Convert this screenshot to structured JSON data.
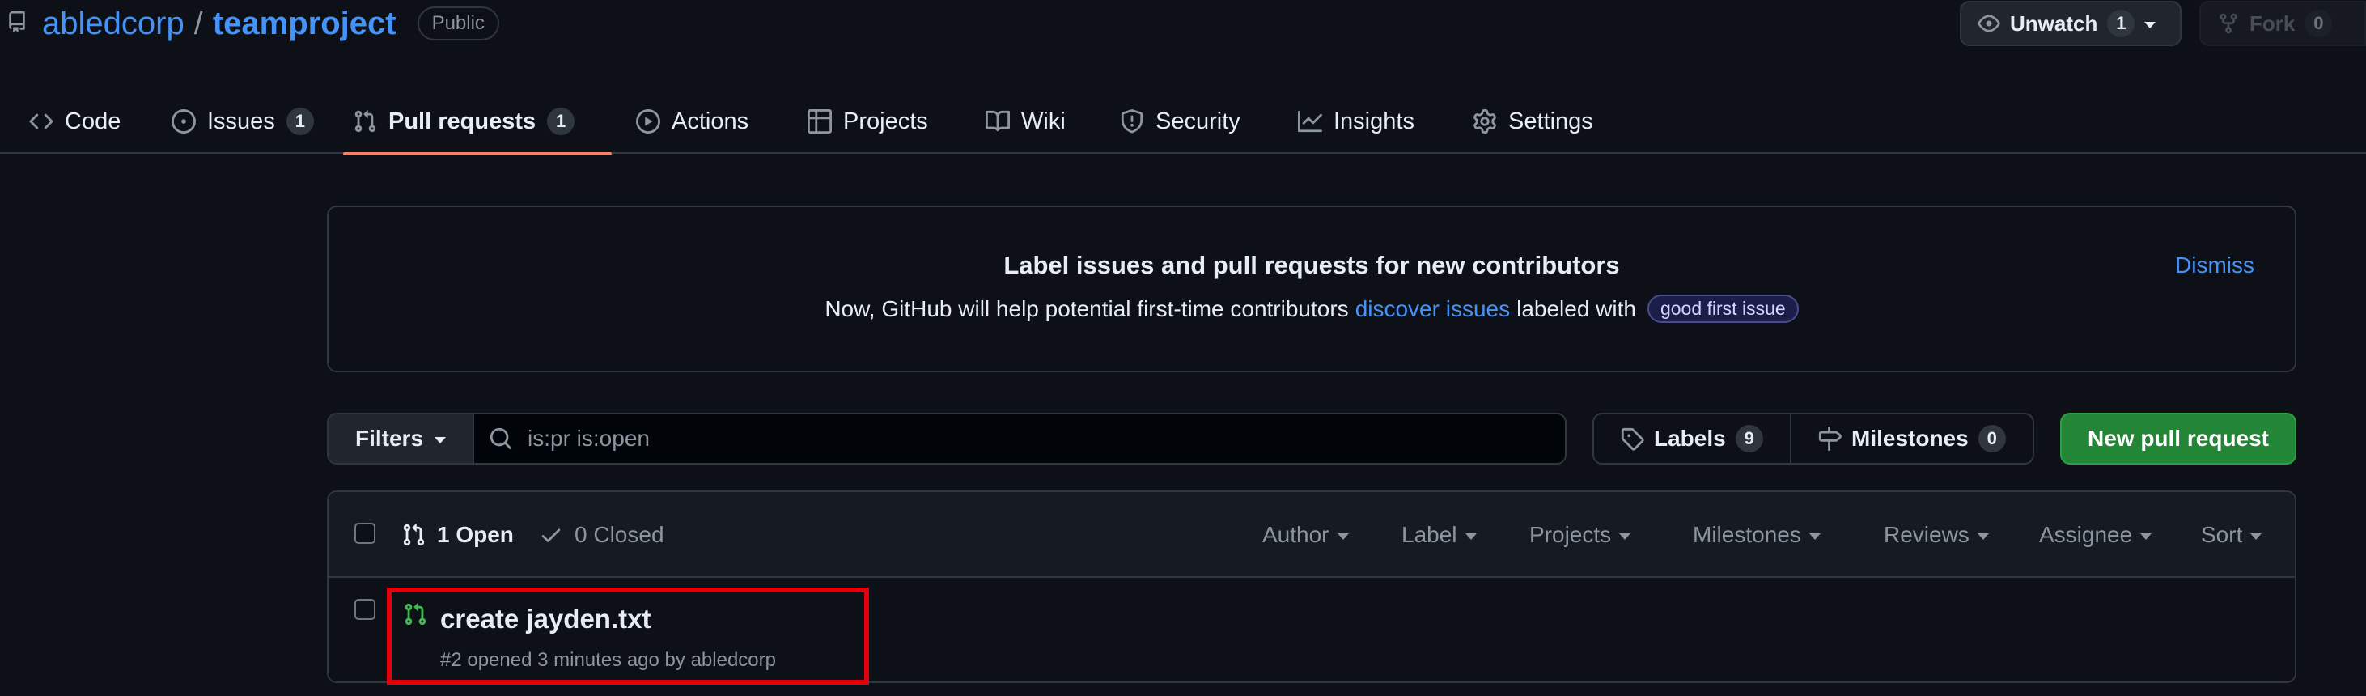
{
  "repo": {
    "owner": "abledcorp",
    "separator": "/",
    "name": "teamproject",
    "visibility": "Public"
  },
  "header_buttons": {
    "unwatch": {
      "label": "Unwatch",
      "count": "1"
    },
    "fork": {
      "label": "Fork",
      "count": "0"
    }
  },
  "tabs": [
    {
      "label": "Code",
      "icon": "code-icon"
    },
    {
      "label": "Issues",
      "icon": "issue-opened-icon",
      "count": "1"
    },
    {
      "label": "Pull requests",
      "icon": "git-pull-request-icon",
      "count": "1",
      "active": true
    },
    {
      "label": "Actions",
      "icon": "play-icon"
    },
    {
      "label": "Projects",
      "icon": "table-icon"
    },
    {
      "label": "Wiki",
      "icon": "book-icon"
    },
    {
      "label": "Security",
      "icon": "shield-icon"
    },
    {
      "label": "Insights",
      "icon": "graph-icon"
    },
    {
      "label": "Settings",
      "icon": "gear-icon"
    }
  ],
  "banner": {
    "title": "Label issues and pull requests for new contributors",
    "text_before": "Now, GitHub will help potential first-time contributors",
    "link": "discover issues",
    "text_after": "labeled with",
    "label_badge": "good first issue",
    "dismiss": "Dismiss"
  },
  "filterbar": {
    "filters_label": "Filters",
    "search_value": "is:pr is:open",
    "labels": {
      "label": "Labels",
      "count": "9"
    },
    "milestones": {
      "label": "Milestones",
      "count": "0"
    },
    "new_pr": "New pull request"
  },
  "list": {
    "open_label": "1 Open",
    "closed_label": "0 Closed",
    "sorters": [
      "Author",
      "Label",
      "Projects",
      "Milestones",
      "Reviews",
      "Assignee",
      "Sort"
    ],
    "items": [
      {
        "title": "create jayden.txt",
        "meta": "#2 opened 3 minutes ago by abledcorp"
      }
    ]
  },
  "colors": {
    "background": "#0d1117",
    "accent_link": "#4493f8",
    "active_tab_underline": "#f78166",
    "primary_button": "#238636",
    "open_pr_icon": "#3fb950",
    "annotation_box": "#e3000b"
  }
}
